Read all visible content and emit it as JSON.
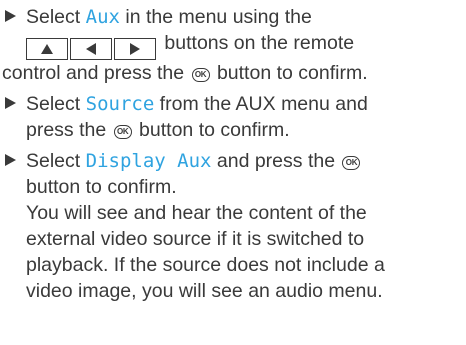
{
  "steps": [
    {
      "line1_pre": "Select ",
      "keyword": "Aux",
      "line1_post": " in the menu using the",
      "line2_post": " buttons on the remote",
      "line3_pre": "control and press the ",
      "ok_label": "OK",
      "line3_post": " button to confirm.",
      "remote_buttons": [
        "up-arrow-icon",
        "left-arrow-icon",
        "right-arrow-icon"
      ]
    },
    {
      "line1_pre": "Select ",
      "keyword": "Source",
      "line1_post": " from the AUX menu and",
      "line2_pre": "press the ",
      "ok_label": "OK",
      "line2_post": " button to confirm."
    },
    {
      "line1_pre": "Select ",
      "keyword": "Display Aux",
      "line1_post": " and press the ",
      "ok_label": "OK",
      "line2": "button to confirm.",
      "result_lines": [
        "You will see and hear the content of the",
        "external video source if it is switched to",
        "playback. If the source does not include a",
        "video image, you will see an audio menu."
      ]
    }
  ],
  "colors": {
    "text": "#3a3a3a",
    "keyword": "#2fa3e0"
  }
}
